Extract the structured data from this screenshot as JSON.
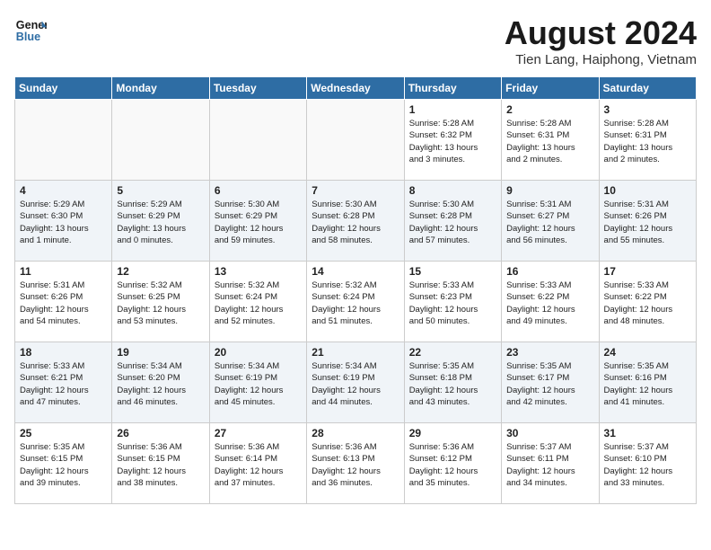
{
  "header": {
    "logo_line1": "General",
    "logo_line2": "Blue",
    "title": "August 2024",
    "subtitle": "Tien Lang, Haiphong, Vietnam"
  },
  "weekdays": [
    "Sunday",
    "Monday",
    "Tuesday",
    "Wednesday",
    "Thursday",
    "Friday",
    "Saturday"
  ],
  "weeks": [
    [
      {
        "day": "",
        "info": ""
      },
      {
        "day": "",
        "info": ""
      },
      {
        "day": "",
        "info": ""
      },
      {
        "day": "",
        "info": ""
      },
      {
        "day": "1",
        "info": "Sunrise: 5:28 AM\nSunset: 6:32 PM\nDaylight: 13 hours\nand 3 minutes."
      },
      {
        "day": "2",
        "info": "Sunrise: 5:28 AM\nSunset: 6:31 PM\nDaylight: 13 hours\nand 2 minutes."
      },
      {
        "day": "3",
        "info": "Sunrise: 5:28 AM\nSunset: 6:31 PM\nDaylight: 13 hours\nand 2 minutes."
      }
    ],
    [
      {
        "day": "4",
        "info": "Sunrise: 5:29 AM\nSunset: 6:30 PM\nDaylight: 13 hours\nand 1 minute."
      },
      {
        "day": "5",
        "info": "Sunrise: 5:29 AM\nSunset: 6:29 PM\nDaylight: 13 hours\nand 0 minutes."
      },
      {
        "day": "6",
        "info": "Sunrise: 5:30 AM\nSunset: 6:29 PM\nDaylight: 12 hours\nand 59 minutes."
      },
      {
        "day": "7",
        "info": "Sunrise: 5:30 AM\nSunset: 6:28 PM\nDaylight: 12 hours\nand 58 minutes."
      },
      {
        "day": "8",
        "info": "Sunrise: 5:30 AM\nSunset: 6:28 PM\nDaylight: 12 hours\nand 57 minutes."
      },
      {
        "day": "9",
        "info": "Sunrise: 5:31 AM\nSunset: 6:27 PM\nDaylight: 12 hours\nand 56 minutes."
      },
      {
        "day": "10",
        "info": "Sunrise: 5:31 AM\nSunset: 6:26 PM\nDaylight: 12 hours\nand 55 minutes."
      }
    ],
    [
      {
        "day": "11",
        "info": "Sunrise: 5:31 AM\nSunset: 6:26 PM\nDaylight: 12 hours\nand 54 minutes."
      },
      {
        "day": "12",
        "info": "Sunrise: 5:32 AM\nSunset: 6:25 PM\nDaylight: 12 hours\nand 53 minutes."
      },
      {
        "day": "13",
        "info": "Sunrise: 5:32 AM\nSunset: 6:24 PM\nDaylight: 12 hours\nand 52 minutes."
      },
      {
        "day": "14",
        "info": "Sunrise: 5:32 AM\nSunset: 6:24 PM\nDaylight: 12 hours\nand 51 minutes."
      },
      {
        "day": "15",
        "info": "Sunrise: 5:33 AM\nSunset: 6:23 PM\nDaylight: 12 hours\nand 50 minutes."
      },
      {
        "day": "16",
        "info": "Sunrise: 5:33 AM\nSunset: 6:22 PM\nDaylight: 12 hours\nand 49 minutes."
      },
      {
        "day": "17",
        "info": "Sunrise: 5:33 AM\nSunset: 6:22 PM\nDaylight: 12 hours\nand 48 minutes."
      }
    ],
    [
      {
        "day": "18",
        "info": "Sunrise: 5:33 AM\nSunset: 6:21 PM\nDaylight: 12 hours\nand 47 minutes."
      },
      {
        "day": "19",
        "info": "Sunrise: 5:34 AM\nSunset: 6:20 PM\nDaylight: 12 hours\nand 46 minutes."
      },
      {
        "day": "20",
        "info": "Sunrise: 5:34 AM\nSunset: 6:19 PM\nDaylight: 12 hours\nand 45 minutes."
      },
      {
        "day": "21",
        "info": "Sunrise: 5:34 AM\nSunset: 6:19 PM\nDaylight: 12 hours\nand 44 minutes."
      },
      {
        "day": "22",
        "info": "Sunrise: 5:35 AM\nSunset: 6:18 PM\nDaylight: 12 hours\nand 43 minutes."
      },
      {
        "day": "23",
        "info": "Sunrise: 5:35 AM\nSunset: 6:17 PM\nDaylight: 12 hours\nand 42 minutes."
      },
      {
        "day": "24",
        "info": "Sunrise: 5:35 AM\nSunset: 6:16 PM\nDaylight: 12 hours\nand 41 minutes."
      }
    ],
    [
      {
        "day": "25",
        "info": "Sunrise: 5:35 AM\nSunset: 6:15 PM\nDaylight: 12 hours\nand 39 minutes."
      },
      {
        "day": "26",
        "info": "Sunrise: 5:36 AM\nSunset: 6:15 PM\nDaylight: 12 hours\nand 38 minutes."
      },
      {
        "day": "27",
        "info": "Sunrise: 5:36 AM\nSunset: 6:14 PM\nDaylight: 12 hours\nand 37 minutes."
      },
      {
        "day": "28",
        "info": "Sunrise: 5:36 AM\nSunset: 6:13 PM\nDaylight: 12 hours\nand 36 minutes."
      },
      {
        "day": "29",
        "info": "Sunrise: 5:36 AM\nSunset: 6:12 PM\nDaylight: 12 hours\nand 35 minutes."
      },
      {
        "day": "30",
        "info": "Sunrise: 5:37 AM\nSunset: 6:11 PM\nDaylight: 12 hours\nand 34 minutes."
      },
      {
        "day": "31",
        "info": "Sunrise: 5:37 AM\nSunset: 6:10 PM\nDaylight: 12 hours\nand 33 minutes."
      }
    ]
  ]
}
